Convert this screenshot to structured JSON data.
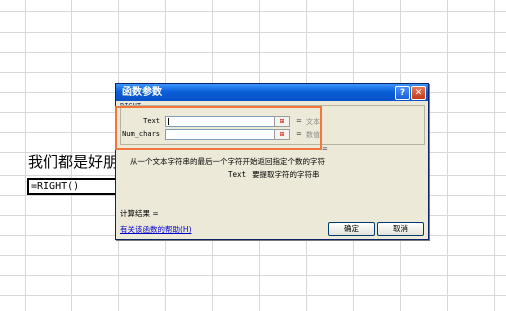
{
  "sheet": {
    "cell_text": "我们都是好朋友",
    "active_cell_formula": "=RIGHT()"
  },
  "dialog": {
    "title": "函数参数",
    "help_button_label": "?",
    "close_button_label": "✕",
    "function_name": "RIGHT",
    "arguments": [
      {
        "label": "Text",
        "value": "",
        "equals": "=",
        "hint": "文本"
      },
      {
        "label": "Num_chars",
        "value": "",
        "equals": "=",
        "hint": "数值"
      }
    ],
    "result_equals": "=",
    "description": "从一个文本字符串的最后一个字符开始返回指定个数的字符",
    "param_name": "Text",
    "param_description": "要提取字符的字符串",
    "calc_result_label": "计算结果 =",
    "help_link": "有关该函数的帮助(H)",
    "ok_label": "确定",
    "cancel_label": "取消"
  },
  "annotation": {
    "color": "#f0783c"
  },
  "icons": {
    "collapse": "collapse-dialog-icon"
  }
}
